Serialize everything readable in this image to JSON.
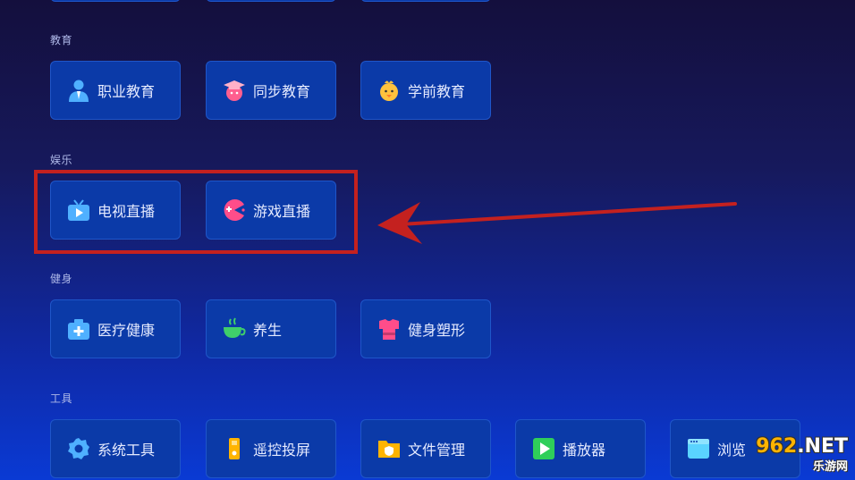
{
  "sections": {
    "education": {
      "label": "教育",
      "items": [
        {
          "label": "职业教育",
          "icon": "person-icon"
        },
        {
          "label": "同步教育",
          "icon": "student-icon"
        },
        {
          "label": "学前教育",
          "icon": "chick-icon"
        }
      ]
    },
    "entertainment": {
      "label": "娱乐",
      "items": [
        {
          "label": "电视直播",
          "icon": "tv-icon"
        },
        {
          "label": "游戏直播",
          "icon": "game-icon"
        }
      ]
    },
    "fitness": {
      "label": "健身",
      "items": [
        {
          "label": "医疗健康",
          "icon": "medical-kit-icon"
        },
        {
          "label": "养生",
          "icon": "tea-cup-icon"
        },
        {
          "label": "健身塑形",
          "icon": "fitness-shirt-icon"
        }
      ]
    },
    "tools": {
      "label": "工具",
      "items": [
        {
          "label": "系统工具",
          "icon": "gear-icon"
        },
        {
          "label": "遥控投屏",
          "icon": "remote-icon"
        },
        {
          "label": "文件管理",
          "icon": "folder-icon"
        },
        {
          "label": "播放器",
          "icon": "play-icon"
        },
        {
          "label": "浏览",
          "icon": "browser-icon"
        }
      ]
    }
  },
  "watermark": {
    "num": "962",
    "suffix": ".NET",
    "sub": "乐游网"
  },
  "colors": {
    "card_bg": "#0b3aa8",
    "highlight": "#c4211f"
  }
}
